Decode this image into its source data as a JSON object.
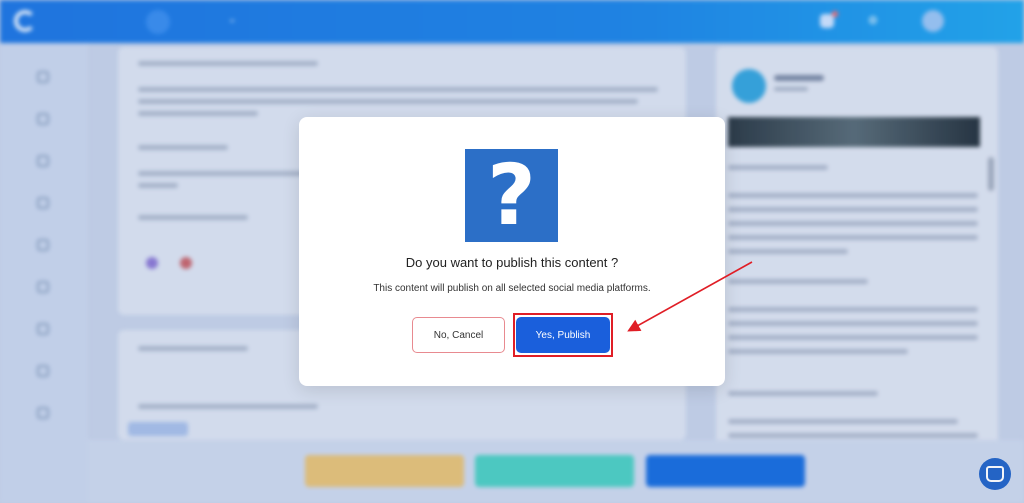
{
  "dialog": {
    "title": "Do you want to publish this content ?",
    "description": "This content will publish on all selected social media platforms.",
    "icon": "question-mark-icon",
    "cancel_label": "No, Cancel",
    "confirm_label": "Yes, Publish",
    "accent_color": "#1a5fdc",
    "icon_color": "#2c6fc7"
  },
  "annotation": {
    "highlight_color": "#e01e26",
    "target": "Yes, Publish"
  },
  "background": {
    "topbar_gradient": [
      "#1f78e4",
      "#22a8ee"
    ],
    "footer_button_colors": [
      "#e8c47a",
      "#4fd1c5",
      "#1a6fe0"
    ]
  }
}
